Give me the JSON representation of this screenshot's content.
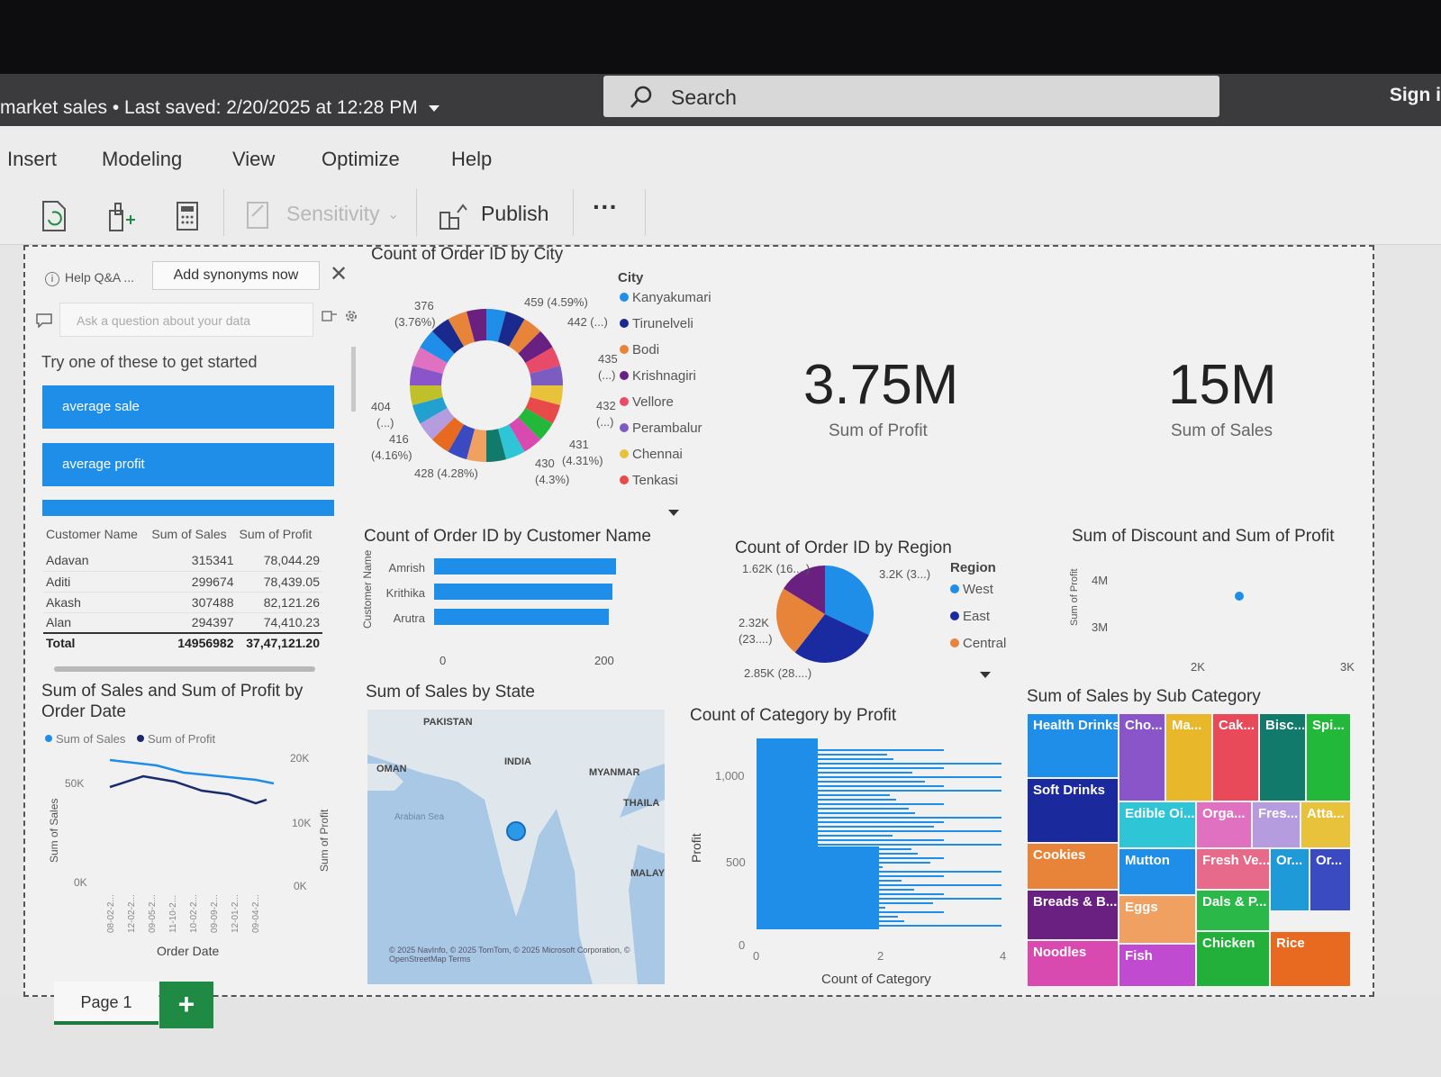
{
  "titlebar": {
    "doc_title": "market sales • Last saved: 2/20/2025 at 12:28 PM",
    "search_label": "Search",
    "signin_label": "Sign i"
  },
  "menu": [
    "Insert",
    "Modeling",
    "View",
    "Optimize",
    "Help"
  ],
  "ribbon": {
    "sensitivity_label": "Sensitivity",
    "publish_label": "Publish",
    "more_label": "···"
  },
  "qa": {
    "help_label": "Help Q&A ...",
    "synonyms_button": "Add synonyms now",
    "input_placeholder": "Ask a question about your data",
    "try_label": "Try one of these to get started",
    "suggestions": [
      "average sale",
      "average profit"
    ]
  },
  "table": {
    "headers": [
      "Customer Name",
      "Sum of Sales",
      "Sum of Profit"
    ],
    "rows": [
      [
        "Adavan",
        "315341",
        "78,044.29"
      ],
      [
        "Aditi",
        "299674",
        "78,439.05"
      ],
      [
        "Akash",
        "307488",
        "82,121.26"
      ],
      [
        "Alan",
        "294397",
        "74,410.23"
      ]
    ],
    "total": [
      "Total",
      "14956982",
      "37,47,121.20"
    ]
  },
  "cards": {
    "profit_value": "3.75M",
    "profit_label": "Sum of Profit",
    "sales_value": "15M",
    "sales_label": "Sum of Sales"
  },
  "visual_titles": {
    "city": "Count of Order ID by City",
    "customer": "Count of Order ID by Customer Name",
    "region": "Count of Order ID by Region",
    "discount": "Sum of Discount and Sum of Profit",
    "line": "Sum of Sales and Sum of Profit by Order Date",
    "state": "Sum of Sales by State",
    "category": "Count of Category by Profit",
    "subcat": "Sum of Sales by Sub Category"
  },
  "city_chart": {
    "legend_title": "City",
    "legend": [
      {
        "name": "Kanyakumari",
        "color": "#1e8ee8"
      },
      {
        "name": "Tirunelveli",
        "color": "#1a2a8c"
      },
      {
        "name": "Bodi",
        "color": "#e8843a"
      },
      {
        "name": "Krishnagiri",
        "color": "#6a2080"
      },
      {
        "name": "Vellore",
        "color": "#e84a6a"
      },
      {
        "name": "Perambalur",
        "color": "#7c5cc0"
      },
      {
        "name": "Chennai",
        "color": "#e8c23a"
      },
      {
        "name": "Tenkasi",
        "color": "#e84a4a"
      }
    ],
    "labels": [
      "376",
      "(3.76%)",
      "459 (4.59%)",
      "442 (...)",
      "435",
      "(...)",
      "432",
      "(...)",
      "431",
      "(4.31%)",
      "430",
      "(4.3%)",
      "428 (4.28%)",
      "416",
      "(4.16%)",
      "404",
      "(...)"
    ]
  },
  "customer_chart": {
    "axis_title": "Customer Name",
    "ticks": [
      "0",
      "200"
    ]
  },
  "region_chart": {
    "legend_title": "Region",
    "legend": [
      {
        "name": "West",
        "color": "#1e8ee8"
      },
      {
        "name": "East",
        "color": "#1a2aa0"
      },
      {
        "name": "Central",
        "color": "#e8843a"
      }
    ],
    "labels": [
      "1.62K (16....)",
      "3.2K (3...)",
      "2.32K",
      "(23....)",
      "2.85K (28....)"
    ]
  },
  "discount_chart": {
    "ylabel": "Sum of Profit",
    "yticks": [
      "4M",
      "3M"
    ],
    "xticks": [
      "2K",
      "3K"
    ]
  },
  "line_chart": {
    "legend": [
      "Sum of Sales",
      "Sum of Profit"
    ],
    "ylabel_left": "Sum of Sales",
    "ylabel_right": "Sum of Profit",
    "left_ticks": [
      "50K",
      "0K"
    ],
    "right_ticks": [
      "20K",
      "10K",
      "0K"
    ],
    "xlabel": "Order Date",
    "xticks": [
      "08-02-2...",
      "12-02-2...",
      "09-05-2...",
      "11-10-2...",
      "10-02-2...",
      "09-09-2...",
      "12-01-2...",
      "09-04-2..."
    ]
  },
  "map": {
    "labels": [
      "PAKISTAN",
      "INDIA",
      "OMAN",
      "MYANMAR",
      "THAILA",
      "MALAY",
      "Arabian Sea"
    ],
    "credits": "© 2025 NavInfo, © 2025 TomTom, © 2025 Microsoft Corporation, © OpenStreetMap  Terms"
  },
  "category_chart": {
    "ylabel": "Profit",
    "xlabel": "Count of Category",
    "yticks": [
      "1,000",
      "500",
      "0"
    ],
    "xticks": [
      "0",
      "2",
      "4"
    ]
  },
  "treemap": [
    {
      "label": "Health Drinks",
      "color": "#1e8ee8"
    },
    {
      "label": "Cho...",
      "color": "#8a55c8"
    },
    {
      "label": "Ma...",
      "color": "#e8b82a"
    },
    {
      "label": "Cak...",
      "color": "#e84a5a"
    },
    {
      "label": "Bisc...",
      "color": "#117a6a"
    },
    {
      "label": "Spi...",
      "color": "#22b83a"
    },
    {
      "label": "Soft Drinks",
      "color": "#1a2a9c"
    },
    {
      "label": "Edible Oi...",
      "color": "#2ec6d6"
    },
    {
      "label": "Orga...",
      "color": "#e070c0"
    },
    {
      "label": "Fres...",
      "color": "#b49cde"
    },
    {
      "label": "Atta...",
      "color": "#e8c23a"
    },
    {
      "label": "Cookies",
      "color": "#e8843a"
    },
    {
      "label": "Mutton",
      "color": "#1e8ee8"
    },
    {
      "label": "Fresh Ve...",
      "color": "#e86a8a"
    },
    {
      "label": "Or...",
      "color": "#1e9ad8"
    },
    {
      "label": "Or...",
      "color": "#3a4ac0"
    },
    {
      "label": "Breads & B...",
      "color": "#6a2080"
    },
    {
      "label": "Eggs",
      "color": "#f0a060"
    },
    {
      "label": "Dals & P...",
      "color": "#2ab848"
    },
    {
      "label": "Noodles",
      "color": "#d84ab0"
    },
    {
      "label": "Fish",
      "color": "#c04ad0"
    },
    {
      "label": "Chicken",
      "color": "#22b03a"
    },
    {
      "label": "Rice",
      "color": "#e86a20"
    }
  ],
  "page_tab": "Page 1",
  "add_tab": "+"
}
